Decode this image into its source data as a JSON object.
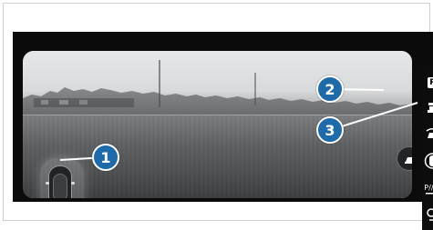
{
  "sidebar": {
    "items": [
      {
        "name": "P",
        "icon": "parking-pilot-icon"
      },
      {
        "name": "",
        "icon": "lift-icon"
      },
      {
        "name": "",
        "icon": "camera-icon"
      },
      {
        "name": "",
        "icon": "360-view-icon"
      },
      {
        "name": "P///A",
        "icon": "parking-assist-icon"
      },
      {
        "name": "",
        "icon": "settings-icon"
      }
    ]
  },
  "callouts": [
    "1",
    "2",
    "3"
  ],
  "colors": {
    "callout_fill": "#1f6aa8",
    "screen_bg": "#0b0b0b",
    "frame_border": "#cfcfcf"
  }
}
